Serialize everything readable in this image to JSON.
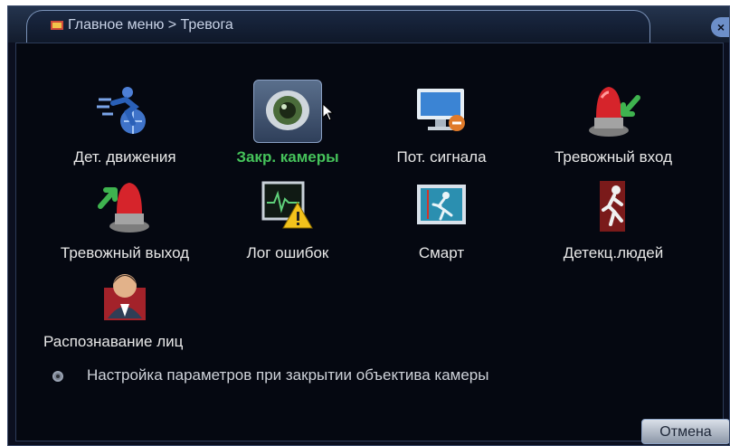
{
  "window": {
    "title": "Главное меню > Тревога",
    "close_symbol": "×"
  },
  "tiles": [
    {
      "label": "Дет. движения",
      "icon": "running-man-globe-icon"
    },
    {
      "label": "Закр. камеры",
      "icon": "camera-lens-icon",
      "selected": true
    },
    {
      "label": "Пот. сигнала",
      "icon": "monitor-video-loss-icon"
    },
    {
      "label": "Тревожный вход",
      "icon": "alarm-light-in-icon"
    },
    {
      "label": "Тревожный выход",
      "icon": "alarm-light-out-icon"
    },
    {
      "label": "Лог ошибок",
      "icon": "error-log-icon"
    },
    {
      "label": "Смарт",
      "icon": "smart-exit-icon"
    },
    {
      "label": "Детекц.людей",
      "icon": "human-detect-icon"
    },
    {
      "label": "Распознавание лиц",
      "icon": "face-recognition-icon"
    }
  ],
  "description": {
    "text": "Настройка параметров при закрытии объектива камеры"
  },
  "buttons": {
    "cancel": "Отмена"
  },
  "colors": {
    "selected_label": "#45c25a",
    "background": "#050811",
    "title_text": "#c8d2e6"
  }
}
